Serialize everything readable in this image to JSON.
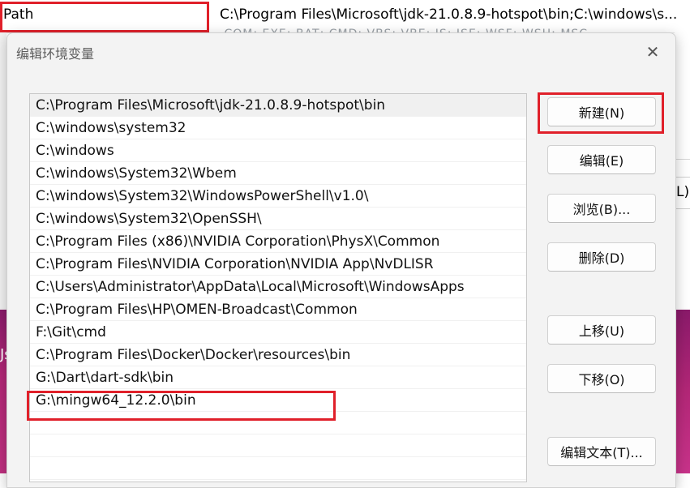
{
  "background": {
    "variable_name": "Path",
    "variable_value": "C:\\Program Files\\Microsoft\\jdk-21.0.8.9-hotspot\\bin;C:\\windows\\s...",
    "second_row_value": ".COM;.EXE;.BAT;.CMD;.VBS;.VBE;.JS;.JSE;.WSF;.WSH;.MSC",
    "left_glyph": "Js",
    "right_glyph": "L)"
  },
  "dialog": {
    "title": "编辑环境变量",
    "close_symbol": "✕",
    "path_items": [
      "C:\\Program Files\\Microsoft\\jdk-21.0.8.9-hotspot\\bin",
      "C:\\windows\\system32",
      "C:\\windows",
      "C:\\windows\\System32\\Wbem",
      "C:\\windows\\System32\\WindowsPowerShell\\v1.0\\",
      "C:\\windows\\System32\\OpenSSH\\",
      "C:\\Program Files (x86)\\NVIDIA Corporation\\PhysX\\Common",
      "C:\\Program Files\\NVIDIA Corporation\\NVIDIA App\\NvDLISR",
      "C:\\Users\\Administrator\\AppData\\Local\\Microsoft\\WindowsApps",
      "C:\\Program Files\\HP\\OMEN-Broadcast\\Common",
      "F:\\Git\\cmd",
      "C:\\Program Files\\Docker\\Docker\\resources\\bin",
      "G:\\Dart\\dart-sdk\\bin",
      "G:\\mingw64_12.2.0\\bin"
    ],
    "buttons": {
      "new": "新建(N)",
      "edit": "编辑(E)",
      "browse": "浏览(B)...",
      "delete": "删除(D)",
      "move_up": "上移(U)",
      "move_down": "下移(O)",
      "edit_text": "编辑文本(T)..."
    }
  },
  "colors": {
    "highlight_box": "#e0202a",
    "dialog_bg": "#f3f3f3",
    "wallpaper": "#b32777"
  }
}
